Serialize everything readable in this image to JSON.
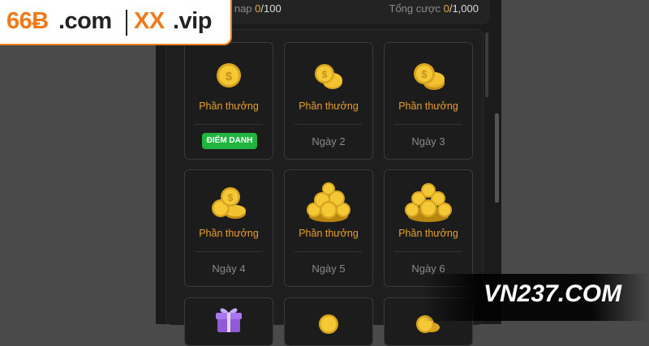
{
  "brand": {
    "logo_part1": "66Ƀ",
    "logo_part2": ".com",
    "logo_part3": "XX",
    "logo_part4": ".vip",
    "logo_color": "#f07a1a",
    "watermark": "VN237.COM"
  },
  "stats": {
    "left_label": "n nap",
    "left_current": "0",
    "left_total": "/100",
    "right_label": "Tổng cược",
    "right_current": "0",
    "right_total": "/1,000"
  },
  "cards": [
    {
      "reward_label": "Phần thưởng",
      "action_label": "ĐIỂM DANH",
      "icon": "coin-single-icon"
    },
    {
      "reward_label": "Phần thưởng",
      "day_label": "Ngày 2",
      "icon": "coins-small-icon"
    },
    {
      "reward_label": "Phần thưởng",
      "day_label": "Ngày 3",
      "icon": "coins-stack-icon"
    },
    {
      "reward_label": "Phần thưởng",
      "day_label": "Ngày 4",
      "icon": "coins-pile-icon"
    },
    {
      "reward_label": "Phần thưởng",
      "day_label": "Ngày 5",
      "icon": "coins-big-pile-icon"
    },
    {
      "reward_label": "Phần thưởng",
      "day_label": "Ngày 6",
      "icon": "coins-big-pile-icon"
    },
    {
      "icon": "gift-box-icon"
    },
    {
      "icon": "coin-single-icon"
    },
    {
      "icon": "coins-small-icon"
    }
  ],
  "colors": {
    "accent": "#e89f2c",
    "checkin_green": "#21b540",
    "coin_gold": "#f2c230"
  }
}
